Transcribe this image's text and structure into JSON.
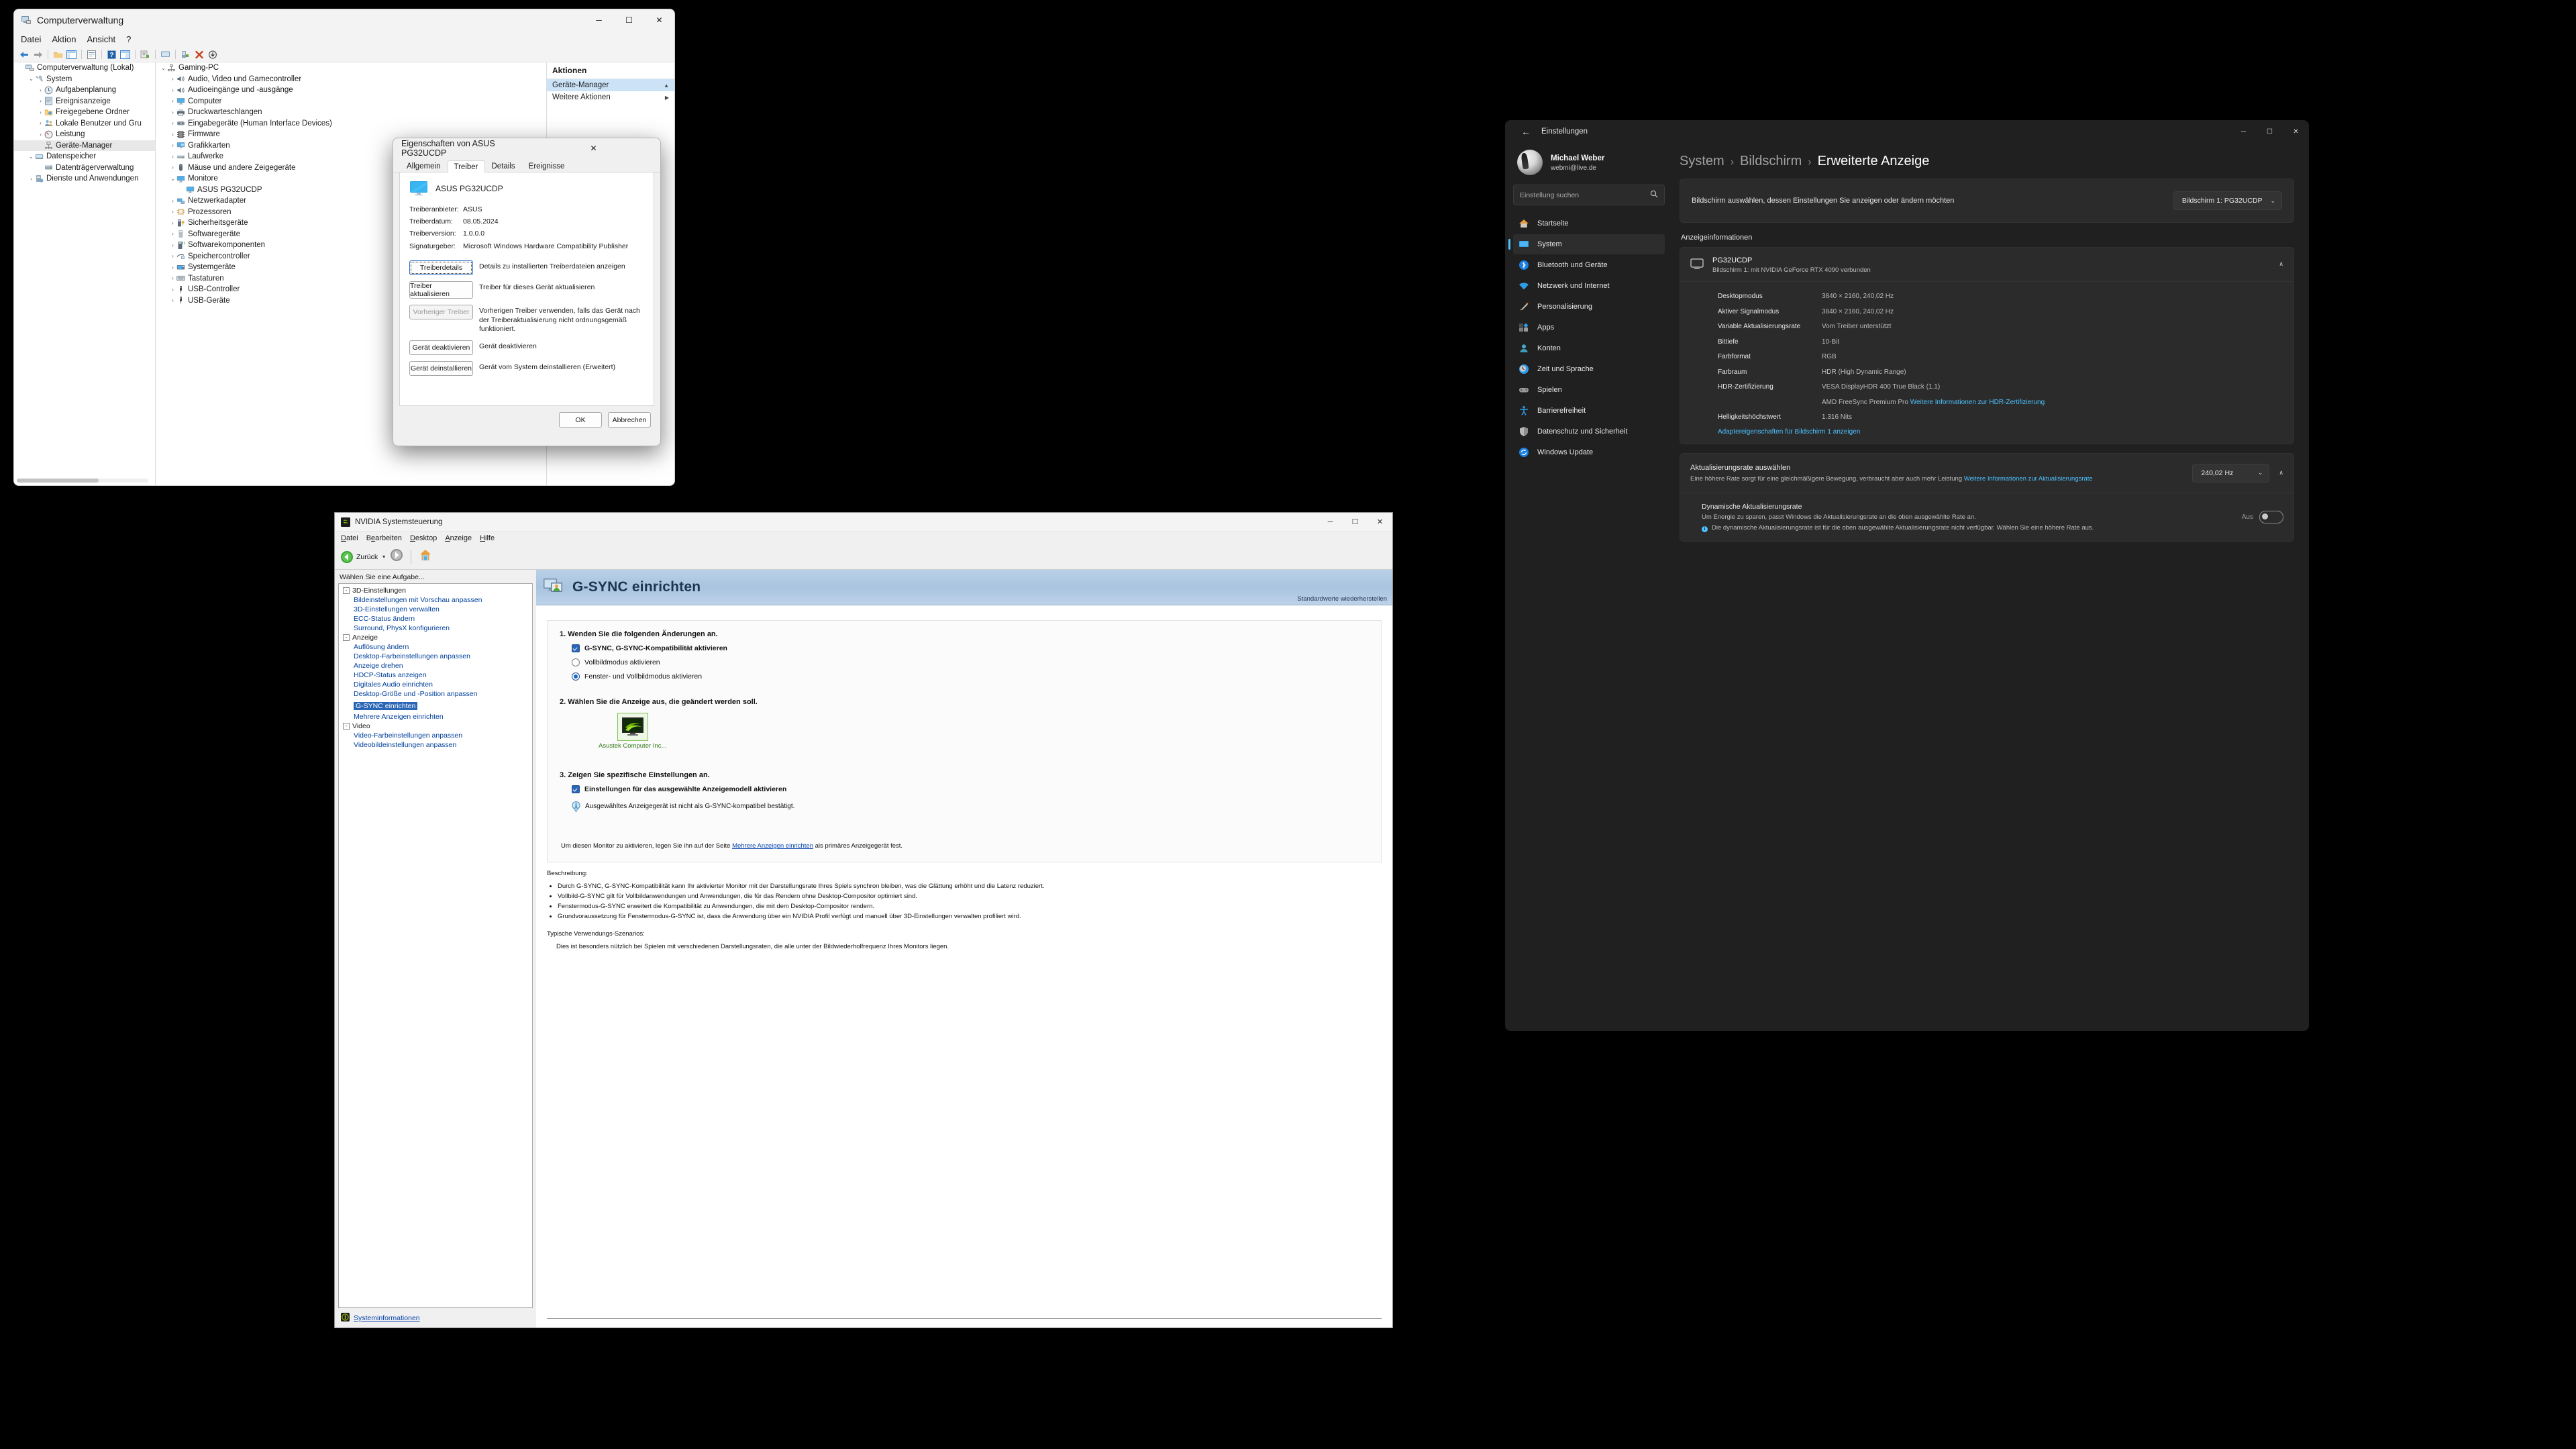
{
  "computer_management": {
    "title": "Computerverwaltung",
    "menu": [
      "Datei",
      "Aktion",
      "Ansicht",
      "?"
    ],
    "window_buttons": {
      "minimize": "─",
      "maximize": "☐",
      "close": "✕"
    },
    "tree_left": [
      {
        "label": "Computerverwaltung (Lokal)",
        "indent": 0,
        "chev": "",
        "icon": "computer-icon"
      },
      {
        "label": "System",
        "indent": 1,
        "chev": "⌄",
        "icon": "tools-icon"
      },
      {
        "label": "Aufgabenplanung",
        "indent": 2,
        "chev": "›",
        "icon": "clock-icon"
      },
      {
        "label": "Ereignisanzeige",
        "indent": 2,
        "chev": "›",
        "icon": "log-icon"
      },
      {
        "label": "Freigegebene Ordner",
        "indent": 2,
        "chev": "›",
        "icon": "folder-icon"
      },
      {
        "label": "Lokale Benutzer und Gru",
        "indent": 2,
        "chev": "›",
        "icon": "users-icon"
      },
      {
        "label": "Leistung",
        "indent": 2,
        "chev": "›",
        "icon": "gauge-icon"
      },
      {
        "label": "Geräte-Manager",
        "indent": 2,
        "chev": "",
        "icon": "device-icon",
        "selected": true
      },
      {
        "label": "Datenspeicher",
        "indent": 1,
        "chev": "⌄",
        "icon": "storage-icon"
      },
      {
        "label": "Datenträgerverwaltung",
        "indent": 2,
        "chev": "",
        "icon": "disk-icon"
      },
      {
        "label": "Dienste und Anwendungen",
        "indent": 1,
        "chev": "›",
        "icon": "services-icon"
      }
    ],
    "tree_center": [
      {
        "label": "Gaming-PC",
        "indent": 0,
        "chev": "⌄",
        "icon": "pc-icon"
      },
      {
        "label": "Audio, Video und Gamecontroller",
        "indent": 1,
        "chev": "›",
        "icon": "speaker-icon"
      },
      {
        "label": "Audioeingänge und -ausgänge",
        "indent": 1,
        "chev": "›",
        "icon": "speaker-icon"
      },
      {
        "label": "Computer",
        "indent": 1,
        "chev": "›",
        "icon": "monitor-icon"
      },
      {
        "label": "Druckwarteschlangen",
        "indent": 1,
        "chev": "›",
        "icon": "printer-icon"
      },
      {
        "label": "Eingabegeräte (Human Interface Devices)",
        "indent": 1,
        "chev": "›",
        "icon": "hid-icon"
      },
      {
        "label": "Firmware",
        "indent": 1,
        "chev": "›",
        "icon": "chip-icon"
      },
      {
        "label": "Grafikkarten",
        "indent": 1,
        "chev": "›",
        "icon": "gpu-icon"
      },
      {
        "label": "Laufwerke",
        "indent": 1,
        "chev": "›",
        "icon": "drive-icon"
      },
      {
        "label": "Mäuse und andere Zeigegeräte",
        "indent": 1,
        "chev": "›",
        "icon": "mouse-icon"
      },
      {
        "label": "Monitore",
        "indent": 1,
        "chev": "⌄",
        "icon": "monitor-icon"
      },
      {
        "label": "ASUS PG32UCDP",
        "indent": 2,
        "chev": "",
        "icon": "monitor-icon"
      },
      {
        "label": "Netzwerkadapter",
        "indent": 1,
        "chev": "›",
        "icon": "network-icon"
      },
      {
        "label": "Prozessoren",
        "indent": 1,
        "chev": "›",
        "icon": "cpu-icon"
      },
      {
        "label": "Sicherheitsgeräte",
        "indent": 1,
        "chev": "›",
        "icon": "security-icon"
      },
      {
        "label": "Softwaregeräte",
        "indent": 1,
        "chev": "›",
        "icon": "software-icon"
      },
      {
        "label": "Softwarekomponenten",
        "indent": 1,
        "chev": "›",
        "icon": "component-icon"
      },
      {
        "label": "Speichercontroller",
        "indent": 1,
        "chev": "›",
        "icon": "storagectl-icon"
      },
      {
        "label": "Systemgeräte",
        "indent": 1,
        "chev": "›",
        "icon": "system-icon"
      },
      {
        "label": "Tastaturen",
        "indent": 1,
        "chev": "›",
        "icon": "keyboard-icon"
      },
      {
        "label": "USB-Controller",
        "indent": 1,
        "chev": "›",
        "icon": "usb-icon"
      },
      {
        "label": "USB-Geräte",
        "indent": 1,
        "chev": "›",
        "icon": "usb-icon"
      }
    ],
    "actions": {
      "header": "Aktionen",
      "items": [
        {
          "label": "Geräte-Manager",
          "arrow": "▲",
          "highlight": true
        },
        {
          "label": "Weitere Aktionen",
          "arrow": "▶",
          "highlight": false
        }
      ]
    }
  },
  "properties_dialog": {
    "title": "Eigenschaften von ASUS PG32UCDP",
    "close": "✕",
    "tabs": [
      "Allgemein",
      "Treiber",
      "Details",
      "Ereignisse"
    ],
    "active_tab": "Treiber",
    "device_name": "ASUS PG32UCDP",
    "fields": [
      {
        "key": "Treiberanbieter:",
        "value": "ASUS"
      },
      {
        "key": "Treiberdatum:",
        "value": "08.05.2024"
      },
      {
        "key": "Treiberversion:",
        "value": "1.0.0.0"
      },
      {
        "key": "Signaturgeber:",
        "value": "Microsoft Windows Hardware Compatibility Publisher"
      }
    ],
    "actions": [
      {
        "button": "Treiberdetails",
        "desc": "Details zu installierten Treiberdateien anzeigen",
        "focus": true,
        "disabled": false
      },
      {
        "button": "Treiber aktualisieren",
        "desc": "Treiber für dieses Gerät aktualisieren",
        "focus": false,
        "disabled": false
      },
      {
        "button": "Vorheriger Treiber",
        "desc": "Vorherigen Treiber verwenden, falls das Gerät nach der Treiberaktualisierung nicht ordnungsgemäß funktioniert.",
        "focus": false,
        "disabled": true
      },
      {
        "button": "Gerät deaktivieren",
        "desc": "Gerät deaktivieren",
        "focus": false,
        "disabled": false
      },
      {
        "button": "Gerät deinstallieren",
        "desc": "Gerät vom System deinstallieren (Erweitert)",
        "focus": false,
        "disabled": false
      }
    ],
    "ok": "OK",
    "cancel": "Abbrechen"
  },
  "nvidia": {
    "title": "NVIDIA Systemsteuerung",
    "window_buttons": {
      "minimize": "─",
      "maximize": "☐",
      "close": "✕"
    },
    "menu": [
      "Datei",
      "Bearbeiten",
      "Desktop",
      "Anzeige",
      "Hilfe"
    ],
    "toolbar": {
      "back": "Zurück",
      "dropdown": "▾"
    },
    "task_header": "Wählen Sie eine Aufgabe...",
    "tree": [
      {
        "type": "cat",
        "label": "3D-Einstellungen"
      },
      {
        "type": "link",
        "label": "Bildeinstellungen mit Vorschau anpassen"
      },
      {
        "type": "link",
        "label": "3D-Einstellungen verwalten"
      },
      {
        "type": "link",
        "label": "ECC-Status ändern"
      },
      {
        "type": "link",
        "label": "Surround, PhysX konfigurieren"
      },
      {
        "type": "cat",
        "label": "Anzeige"
      },
      {
        "type": "link",
        "label": "Auflösung ändern"
      },
      {
        "type": "link",
        "label": "Desktop-Farbeinstellungen anpassen"
      },
      {
        "type": "link",
        "label": "Anzeige drehen"
      },
      {
        "type": "link",
        "label": "HDCP-Status anzeigen"
      },
      {
        "type": "link",
        "label": "Digitales Audio einrichten"
      },
      {
        "type": "link",
        "label": "Desktop-Größe und -Position anpassen"
      },
      {
        "type": "link",
        "label": "G-SYNC einrichten",
        "selected": true
      },
      {
        "type": "link",
        "label": "Mehrere Anzeigen einrichten"
      },
      {
        "type": "cat",
        "label": "Video"
      },
      {
        "type": "link",
        "label": "Video-Farbeinstellungen anpassen"
      },
      {
        "type": "link",
        "label": "Videobildeinstellungen anpassen"
      }
    ],
    "system_info_link": "Systeminformationen",
    "page": {
      "heading": "G-SYNC einrichten",
      "restore": "Standardwerte wiederherstellen",
      "step1_title": "1. Wenden Sie die folgenden Änderungen an.",
      "step1_checkbox": "G-SYNC, G-SYNC-Kompatibilität aktivieren",
      "step1_radio1": "Vollbildmodus aktivieren",
      "step1_radio2": "Fenster- und Vollbildmodus aktivieren",
      "step1_selected_radio": 2,
      "step2_title": "2. Wählen Sie die Anzeige aus, die geändert werden soll.",
      "step2_monitor_label": "Asustek Computer Inc...",
      "step3_title": "3. Zeigen Sie spezifische Einstellungen an.",
      "step3_checkbox": "Einstellungen für das ausgewählte Anzeigemodell aktivieren",
      "step3_info": "Ausgewähltes Anzeigegerät ist nicht als G-SYNC-kompatibel bestätigt.",
      "primary_note_a": "Um diesen Monitor zu aktivieren, legen Sie ihn auf der Seite ",
      "primary_note_link": "Mehrere Anzeigen einrichten",
      "primary_note_b": " als primäres Anzeigegerät fest.",
      "description_title": "Beschreibung:",
      "description_bullets": [
        "Durch G-SYNC, G-SYNC-Kompatibilität kann Ihr aktivierter Monitor mit der Darstellungsrate Ihres Spiels synchron bleiben, was die Glättung erhöht und die Latenz reduziert.",
        "Vollbild-G-SYNC gilt für Vollbildanwendungen und Anwendungen, die für das Rendern ohne Desktop-Compositor optimiert sind.",
        "Fenstermodus-G-SYNC erweitert die Kompatibilität zu Anwendungen, die mit dem Desktop-Compositor rendern.",
        "Grundvoraussetzung für Fenstermodus-G-SYNC ist, dass die Anwendung über ein NVIDIA Profil verfügt und manuell über 3D-Einstellungen verwalten profiliert wird."
      ],
      "scenarios_title": "Typische Verwendungs-Szenarios:",
      "scenarios_text": "Dies ist besonders nützlich bei Spielen mit verschiedenen Darstellungsraten, die alle unter der Bildwiederholfrequenz Ihres Monitors liegen."
    }
  },
  "settings": {
    "app_title": "Einstellungen",
    "back_icon": "←",
    "window_buttons": {
      "minimize": "─",
      "maximize": "☐",
      "close": "✕"
    },
    "user": {
      "name": "Michael Weber",
      "email": "webmi@live.de"
    },
    "search": {
      "placeholder": "Einstellung suchen",
      "icon": "search-icon"
    },
    "nav": [
      {
        "label": "Startseite",
        "icon": "home-icon",
        "active": false
      },
      {
        "label": "System",
        "icon": "system-icon",
        "active": true
      },
      {
        "label": "Bluetooth und Geräte",
        "icon": "bluetooth-icon",
        "active": false
      },
      {
        "label": "Netzwerk und Internet",
        "icon": "network-icon",
        "active": false
      },
      {
        "label": "Personalisierung",
        "icon": "brush-icon",
        "active": false
      },
      {
        "label": "Apps",
        "icon": "apps-icon",
        "active": false
      },
      {
        "label": "Konten",
        "icon": "accounts-icon",
        "active": false
      },
      {
        "label": "Zeit und Sprache",
        "icon": "clock-icon",
        "active": false
      },
      {
        "label": "Spielen",
        "icon": "gamepad-icon",
        "active": false
      },
      {
        "label": "Barrierefreiheit",
        "icon": "accessibility-icon",
        "active": false
      },
      {
        "label": "Datenschutz und Sicherheit",
        "icon": "shield-icon",
        "active": false
      },
      {
        "label": "Windows Update",
        "icon": "update-icon",
        "active": false
      }
    ],
    "breadcrumb": [
      "System",
      "Bildschirm",
      "Erweiterte Anzeige"
    ],
    "breadcrumb_sep": "›",
    "display_picker": {
      "label": "Bildschirm auswählen, dessen Einstellungen Sie anzeigen oder ändern möchten",
      "value": "Bildschirm 1: PG32UCDP",
      "chevron": "⌄"
    },
    "section_title": "Anzeigeinformationen",
    "display_card": {
      "name": "PG32UCDP",
      "sub": "Bildschirm 1: mit NVIDIA GeForce RTX 4090 verbunden",
      "chevron": "∧",
      "rows": [
        {
          "key": "Desktopmodus",
          "value": "3840 × 2160, 240,02 Hz"
        },
        {
          "key": "Aktiver Signalmodus",
          "value": "3840 × 2160, 240,02 Hz"
        },
        {
          "key": "Variable Aktualisierungsrate",
          "value": "Vom Treiber unterstützt"
        },
        {
          "key": "Bittiefe",
          "value": "10-Bit"
        },
        {
          "key": "Farbformat",
          "value": "RGB"
        },
        {
          "key": "Farbraum",
          "value": "HDR (High Dynamic Range)"
        },
        {
          "key": "HDR-Zertifizierung",
          "value": "VESA DisplayHDR 400 True Black (1.1)"
        },
        {
          "key": "",
          "value": "AMD FreeSync Premium Pro",
          "link": "Weitere Informationen zur HDR-Zertifizierung"
        },
        {
          "key": "Helligkeitshöchstwert",
          "value": "1.316 Nits"
        }
      ],
      "adapter_link": "Adaptereigenschaften für Bildschirm 1 anzeigen"
    },
    "refresh": {
      "title": "Aktualisierungsrate auswählen",
      "desc": "Eine höhere Rate sorgt für eine gleichmäßigere Bewegung, verbraucht aber auch mehr Leistung ",
      "desc_link": "Weitere Informationen zur Aktualisierungsrate",
      "value": "240,02 Hz",
      "chevron": "⌄",
      "expand_chevron": "∧"
    },
    "dynamic": {
      "title": "Dynamische Aktualisierungsrate",
      "desc": "Um Energie zu sparen, passt Windows die Aktualisierungsrate an die oben ausgewählte Rate an.",
      "info": "Die dynamische Aktualisierungsrate ist für die oben ausgewählte Aktualisierungsrate nicht verfügbar. Wählen Sie eine höhere Rate aus.",
      "toggle_label": "Aus",
      "info_icon": "i"
    }
  },
  "colors": {
    "accent_blue": "#4cc2ff",
    "nvidia_green": "#76b900",
    "link_blue": "#0645ad",
    "selection_blue": "#cce3f7",
    "settings_bg": "#202020",
    "card_bg": "#2b2b2b"
  }
}
